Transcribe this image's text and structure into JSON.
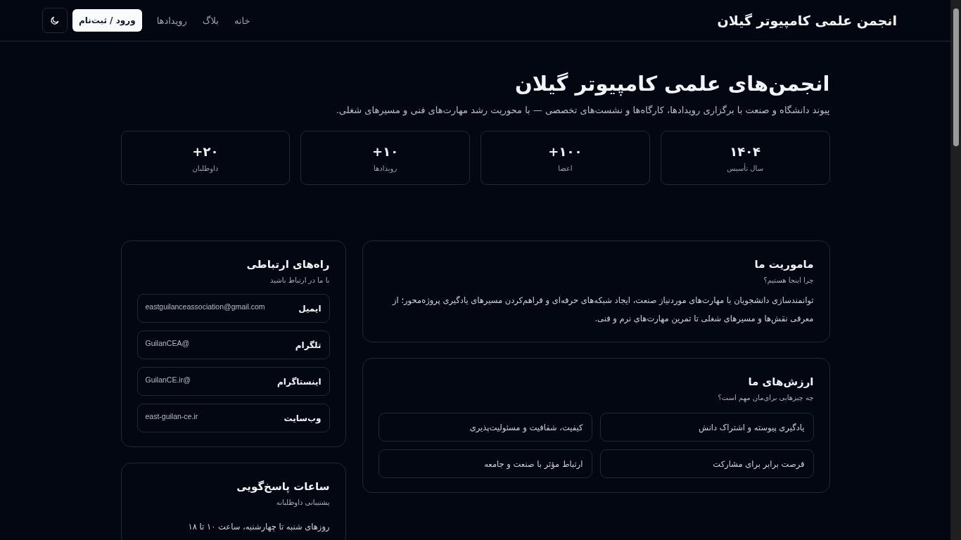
{
  "header": {
    "brand": "انجمن علمی کامپیوتر گیلان",
    "nav": [
      {
        "label": "خانه"
      },
      {
        "label": "بلاگ"
      },
      {
        "label": "رویدادها"
      }
    ],
    "login_button": "ورود / ثبت‌نام"
  },
  "hero": {
    "title": "انجمن‌های علمی کامپیوتر گیلان",
    "subtitle": "پیوند دانشگاه و صنعت با برگزاری رویدادها، کارگاه‌ها و نشست‌های تخصصی — با محوریت رشد مهارت‌های فنی و مسیرهای شغلی."
  },
  "stats": [
    {
      "value": "۱۴۰۴",
      "label": "سال تأسیس"
    },
    {
      "value": "+۱۰۰",
      "label": "اعضا"
    },
    {
      "value": "+۱۰",
      "label": "رویدادها"
    },
    {
      "value": "+۲۰",
      "label": "داوطلبان"
    }
  ],
  "mission": {
    "title": "ماموریت ما",
    "subtitle": "چرا اینجا هستیم؟",
    "text": "توانمندسازی دانشجویان با مهارت‌های موردنیاز صنعت، ایجاد شبکه‌های حرفه‌ای و فراهم‌کردن مسیرهای یادگیری پروژه‌محور؛ از معرفی نقش‌ها و مسیرهای شغلی تا تمرین مهارت‌های نرم و فنی."
  },
  "values": {
    "title": "ارزش‌های ما",
    "subtitle": "چه چیزهایی برای‌مان مهم است؟",
    "items": [
      "یادگیری پیوسته و اشتراک دانش",
      "کیفیت، شفافیت و مسئولیت‌پذیری",
      "فرصت برابر برای مشارکت",
      "ارتباط مؤثر با صنعت و جامعه"
    ]
  },
  "contact": {
    "title": "راه‌های ارتباطی",
    "subtitle": "با ما در ارتباط باشید",
    "items": [
      {
        "label": "ایمیل",
        "value": "eastguilanceassociation@gmail.com"
      },
      {
        "label": "تلگرام",
        "value": "GuilanCEA@"
      },
      {
        "label": "اینستاگرام",
        "value": "GuilanCE.ir@"
      },
      {
        "label": "وب‌سایت",
        "value": "east-guilan-ce.ir"
      }
    ]
  },
  "hours": {
    "title": "ساعات پاسخ‌گویی",
    "subtitle": "پشتیبانی داوطلبانه",
    "text": "روزهای شنبه تا چهارشنبه، ساعت ۱۰ تا ۱۸"
  }
}
